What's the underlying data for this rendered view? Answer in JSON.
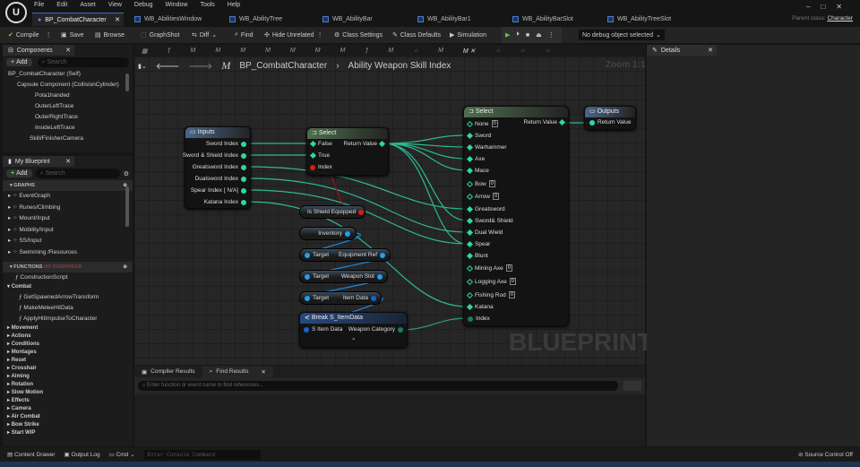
{
  "menu": [
    "File",
    "Edit",
    "Asset",
    "View",
    "Debug",
    "Window",
    "Tools",
    "Help"
  ],
  "tabs": [
    "BP_CombatCharacter",
    "WB_AbilitiesWindow",
    "WB_AbilityTree",
    "WB_AbilityBar",
    "WB_AbilityBar1",
    "WB_AbilityBarSlot",
    "WB_AbilityTreeSlot"
  ],
  "parent_class": {
    "label": "Parent class:",
    "value": "Character"
  },
  "toolbar": {
    "compile": "Compile",
    "save": "Save",
    "browse": "Browse",
    "graphshot": "GraphShot",
    "diff": "Diff",
    "find": "Find",
    "hide_unrelated": "Hide Unrelated",
    "class_settings": "Class Settings",
    "class_defaults": "Class Defaults",
    "simulation": "Simulation",
    "debug_object": "No debug object selected"
  },
  "components": {
    "title": "Components",
    "add": "Add",
    "search_placeholder": "Search",
    "items": [
      "BP_CombatCharacter (Self)",
      "Capsule Component (CollisionCylinder)",
      "Pota1handed",
      "OuterLeftTrace",
      "OuterRightTrace",
      "InsideLeftTrace",
      "Skill/FinisherCamera"
    ]
  },
  "my_blueprint": {
    "title": "My Blueprint",
    "add": "Add",
    "search_placeholder": "Search",
    "graphs_label": "GRAPHS",
    "graphs": [
      "EventGraph",
      "Runes/Climbing",
      "Mount/Input",
      "Mobility/Input",
      "SS/Input",
      "Swimming /Resources"
    ],
    "functions_label": "FUNCTIONS",
    "functions_count": "(89 OVERRIDAB",
    "construction": "ConstructionScript",
    "combat": "Combat",
    "combat_functions": [
      "GetSpawnedArrowTransform",
      "MakeMeleeHitData",
      "ApplyHitImpulseToCharacter"
    ],
    "categories": [
      "Movement",
      "Actions",
      "Conditions",
      "Montages",
      "Reset",
      "Crosshair",
      "Aiming",
      "Rotation",
      "Slow Motion",
      "Effects",
      "Camera",
      "Air Combat",
      "Bow Strike",
      "Start WIP"
    ]
  },
  "graph": {
    "breadcrumb_root": "BP_CombatCharacter",
    "breadcrumb_leaf": "Ability Weapon Skill Index",
    "zoom": "Zoom 1:1",
    "watermark": "BLUEPRINT",
    "inputs_node": {
      "title": "Inputs",
      "pins": [
        "Sword Index",
        "Sword & Shield Index",
        "Greatsword Index",
        "Dualsword Index",
        "Spear Index [ N/A]",
        "Katana Index"
      ]
    },
    "select1": {
      "title": "Select",
      "pins": [
        "False",
        "True",
        "Index"
      ],
      "output": "Return Value"
    },
    "is_shield": "Is Shield Equipped",
    "inventory": "Inventory",
    "target": "Target",
    "equipment_ref": "Equipment Ref",
    "weapon_slot": "Weapon Slot",
    "item_data": "Item Data",
    "break": {
      "title": "Break S_ItemData",
      "input": "S Item Data",
      "output": "Weapon Category"
    },
    "select2": {
      "title": "Select",
      "output": "Return Value",
      "pins": [
        {
          "l": "None",
          "v": "0"
        },
        {
          "l": "Sword"
        },
        {
          "l": "Warhammer"
        },
        {
          "l": "Axe"
        },
        {
          "l": "Mace"
        },
        {
          "l": "Bow",
          "v": "0"
        },
        {
          "l": "Arrow",
          "v": "0"
        },
        {
          "l": "Greatsword"
        },
        {
          "l": "Sword& Shield"
        },
        {
          "l": "Dual Wield"
        },
        {
          "l": "Spear"
        },
        {
          "l": "Blunt"
        },
        {
          "l": "Mining Axe",
          "v": "0"
        },
        {
          "l": "Logging Axe",
          "v": "0"
        },
        {
          "l": "Fishing Rod",
          "v": "0"
        },
        {
          "l": "Katana"
        },
        {
          "l": "Index"
        }
      ]
    },
    "outputs": {
      "title": "Outputs",
      "pin": "Return Value"
    }
  },
  "details": {
    "title": "Details"
  },
  "bottom": {
    "compiler_results": "Compiler Results",
    "find_results": "Find Results",
    "find_placeholder": "Enter function or event name to find references..."
  },
  "status": {
    "content_drawer": "Content Drawer",
    "output_log": "Output Log",
    "cmd": "Cmd",
    "console_placeholder": "Enter Console Command",
    "source_control": "Source Control Off"
  }
}
